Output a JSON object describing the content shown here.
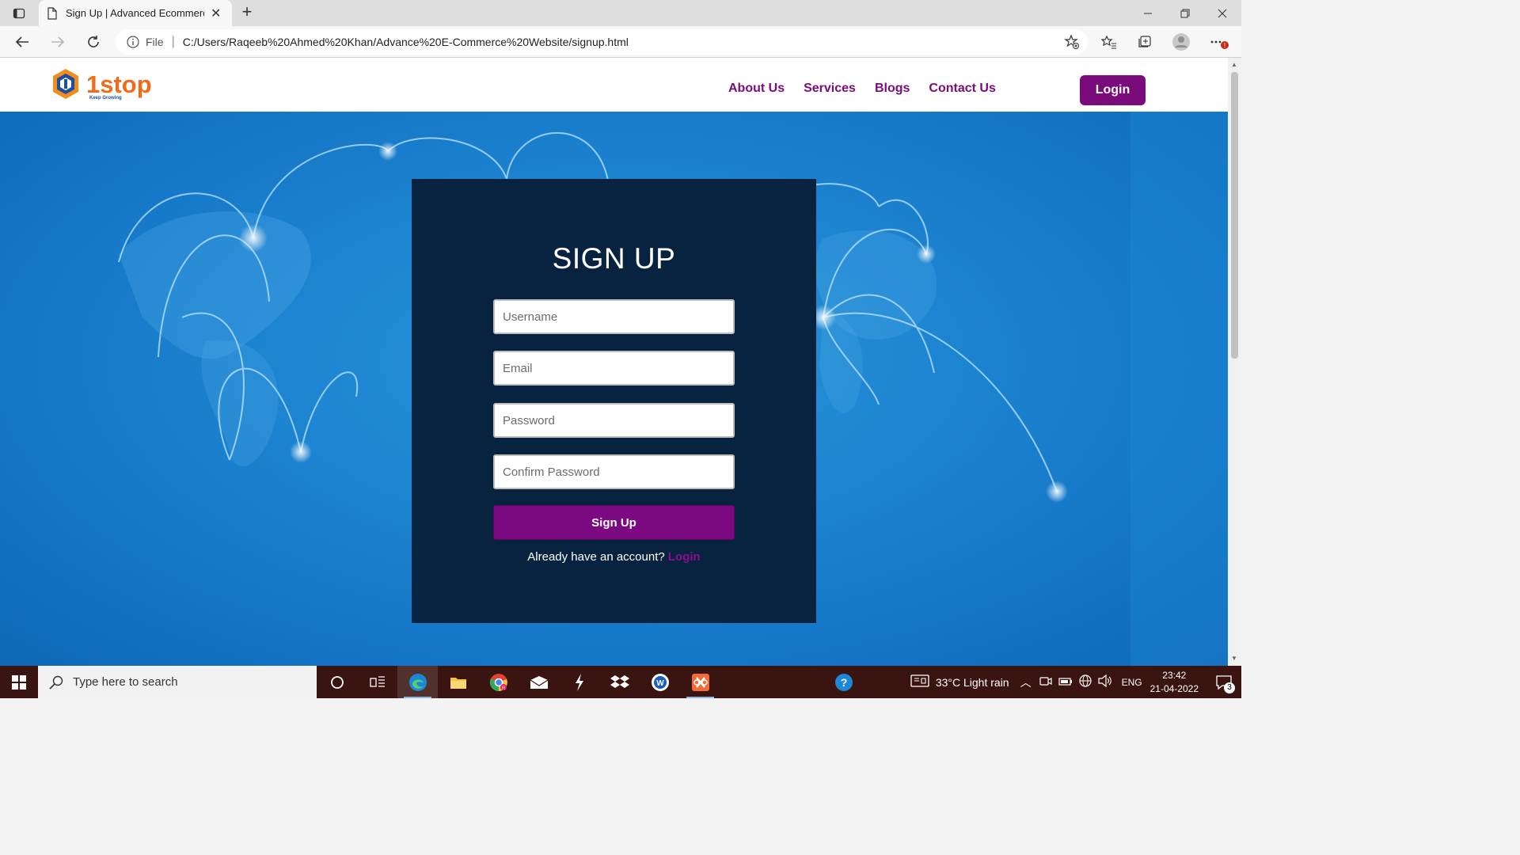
{
  "browser": {
    "tab_title": "Sign Up | Advanced Ecommerce",
    "address_prefix": "File",
    "url": "C:/Users/Raqeeb%20Ahmed%20Khan/Advance%20E-Commerce%20Website/signup.html"
  },
  "site": {
    "logo_text": "1stop",
    "logo_tagline": "Keep Growing",
    "nav": [
      "About Us",
      "Services",
      "Blogs",
      "Contact Us"
    ],
    "login_label": "Login",
    "brand_color": "#7a0b7a"
  },
  "form": {
    "title": "SIGN UP",
    "username_placeholder": "Username",
    "email_placeholder": "Email",
    "password_placeholder": "Password",
    "confirm_placeholder": "Confirm Password",
    "submit_label": "Sign Up",
    "already_text": "Already have an account?",
    "login_link": "Login"
  },
  "taskbar": {
    "search_placeholder": "Type here to search",
    "weather": "33°C  Light rain",
    "language": "ENG",
    "time": "23:42",
    "date": "21-04-2022",
    "notification_count": "3"
  }
}
